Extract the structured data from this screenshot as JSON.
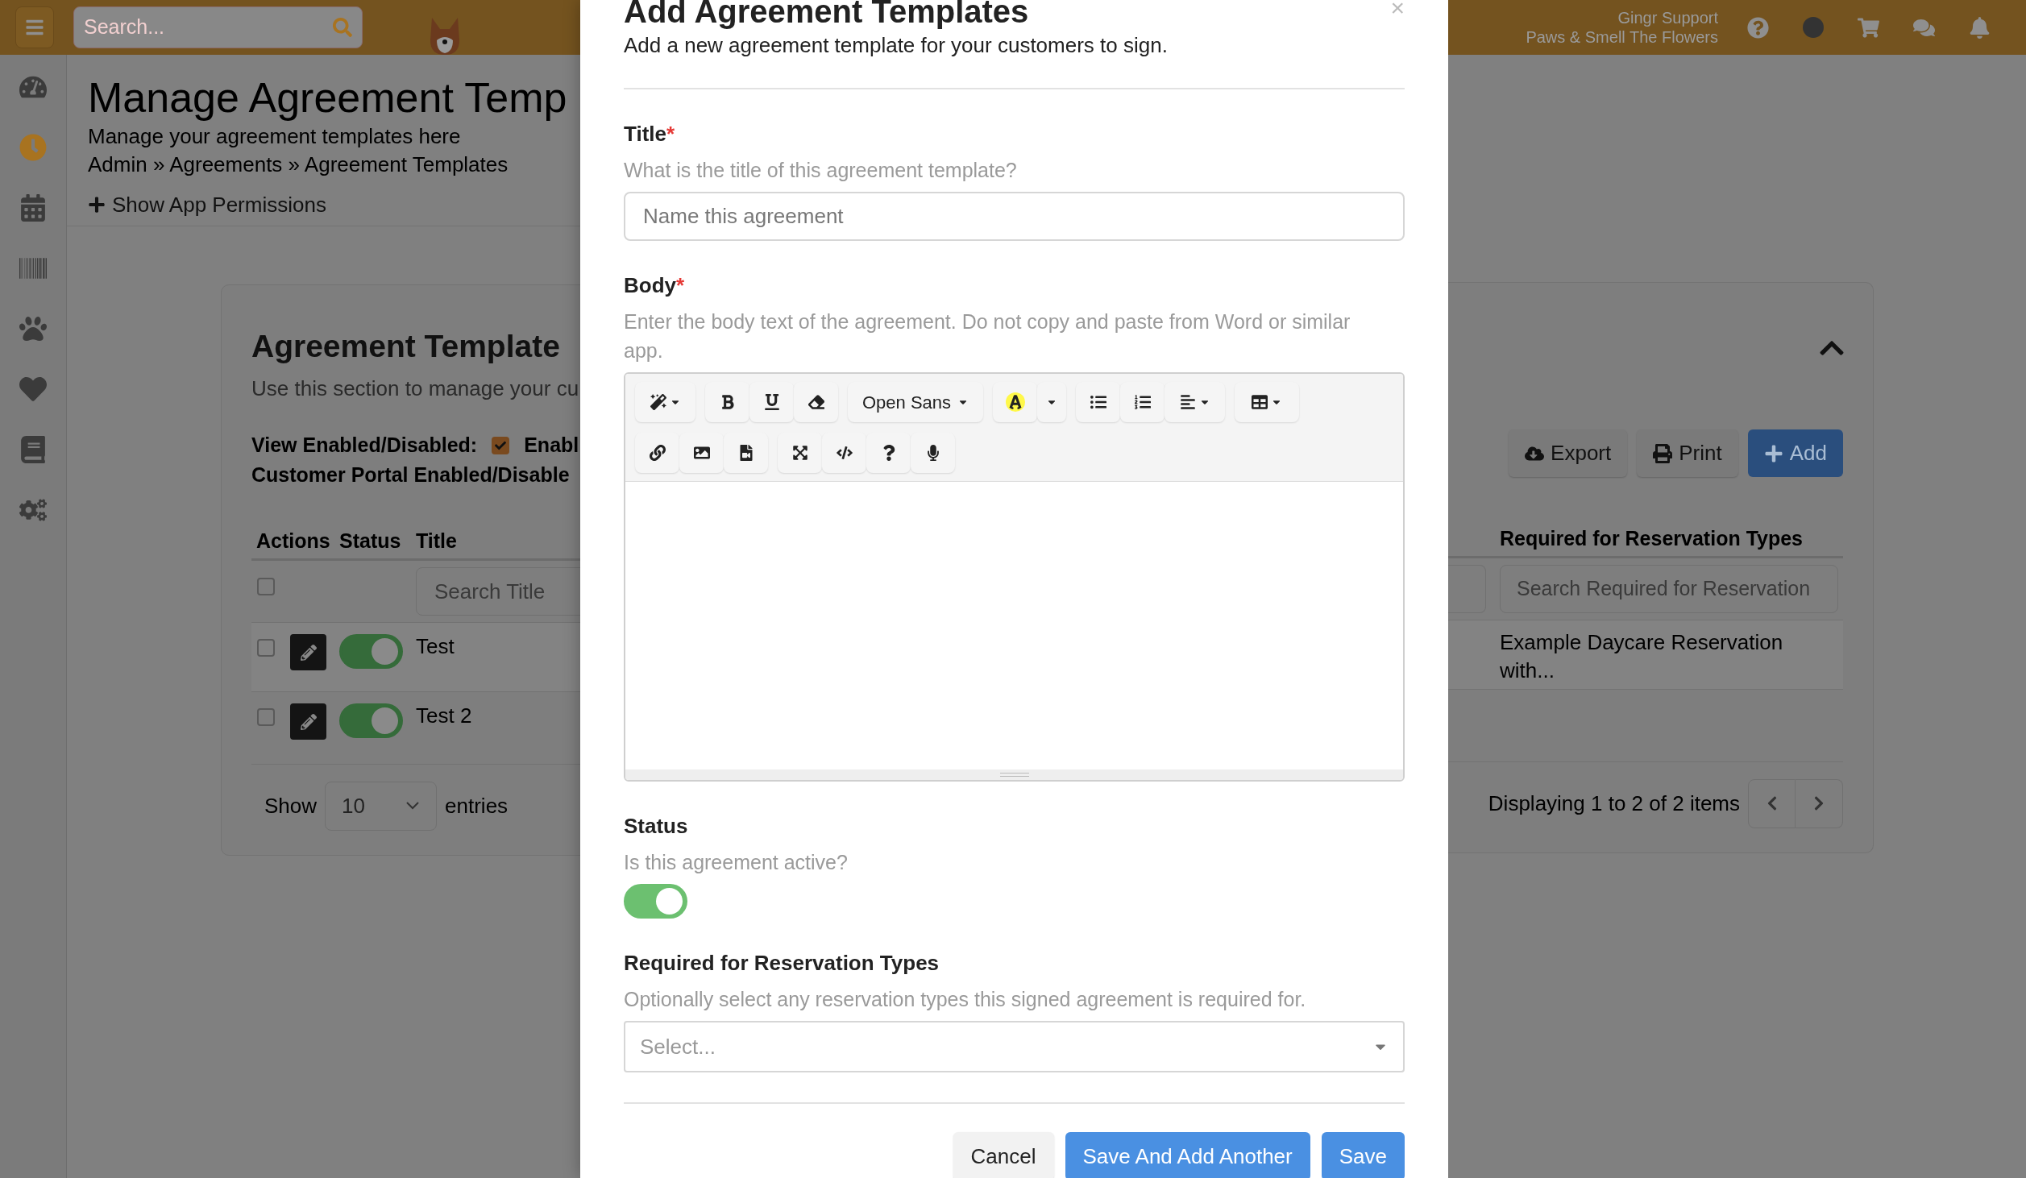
{
  "topbar": {
    "search": {
      "placeholder": "Search..."
    },
    "account": {
      "name": "Gingr Support",
      "location": "Paws & Smell The Flowers"
    }
  },
  "sidebar": {
    "items": [
      {
        "selected": false
      },
      {
        "selected": true
      },
      {
        "selected": false
      },
      {
        "selected": false
      },
      {
        "selected": false
      },
      {
        "selected": false
      },
      {
        "selected": false
      },
      {
        "selected": false
      }
    ]
  },
  "page": {
    "title": "Manage Agreement Temp",
    "subtitle": "Manage your agreement templates here",
    "breadcrumb": "Admin » Agreements » Agreement Templates",
    "permissions_link": "Show App Permissions"
  },
  "card": {
    "title": "Agreement Template",
    "description": "Use this section to manage your cu",
    "filter_label": "View Enabled/Disabled:",
    "filter_checked": true,
    "filter_option": "Enabl",
    "portal_label": "Customer Portal Enabled/Disable",
    "buttons": [
      {
        "label": "Export",
        "kind": "export"
      },
      {
        "label": "Print",
        "kind": "print"
      },
      {
        "label": "Add",
        "kind": "add"
      }
    ],
    "table": {
      "columns": [
        "Actions",
        "Status",
        "Title",
        "Required for Reservation Types"
      ],
      "select_all_checked": false,
      "title_filter": {
        "placeholder": "Search Title"
      },
      "required_filter": {
        "placeholder": "Search Required for Reservation"
      },
      "rows": [
        {
          "checked": false,
          "on": true,
          "title": "Test",
          "required": "Example Daycare Reservation with..."
        },
        {
          "checked": false,
          "on": true,
          "title": "Test 2"
        }
      ]
    },
    "length_label": "Show",
    "length_value": "10",
    "length_suffix": "entries",
    "info": "Displaying 1 to 2 of 2 items"
  },
  "modal": {
    "title": "Add Agreement Templates",
    "close": "×",
    "subtitle": "Add a new agreement template for your customers to sign.",
    "fields": [
      {
        "kind": "text",
        "label": "Title",
        "required_mark": "*",
        "hint": "What is the title of this agreement template?",
        "placeholder": "Name this agreement"
      },
      {
        "kind": "editor",
        "label": "Body",
        "required_mark": "*",
        "hint": "Enter the body text of the agreement. Do not copy and paste from Word or similar app.",
        "font": "Open Sans"
      },
      {
        "kind": "toggle",
        "label": "Status",
        "hint": "Is this agreement active?",
        "on": true
      },
      {
        "kind": "select",
        "label": "Required for Reservation Types",
        "hint": "Optionally select any reservation types this signed agreement is required for.",
        "placeholder": "Select..."
      }
    ],
    "buttons": [
      {
        "label": "Cancel",
        "kind": "secondary"
      },
      {
        "label": "Save And Add Another",
        "kind": "primary"
      },
      {
        "label": "Save",
        "kind": "primary"
      }
    ]
  }
}
